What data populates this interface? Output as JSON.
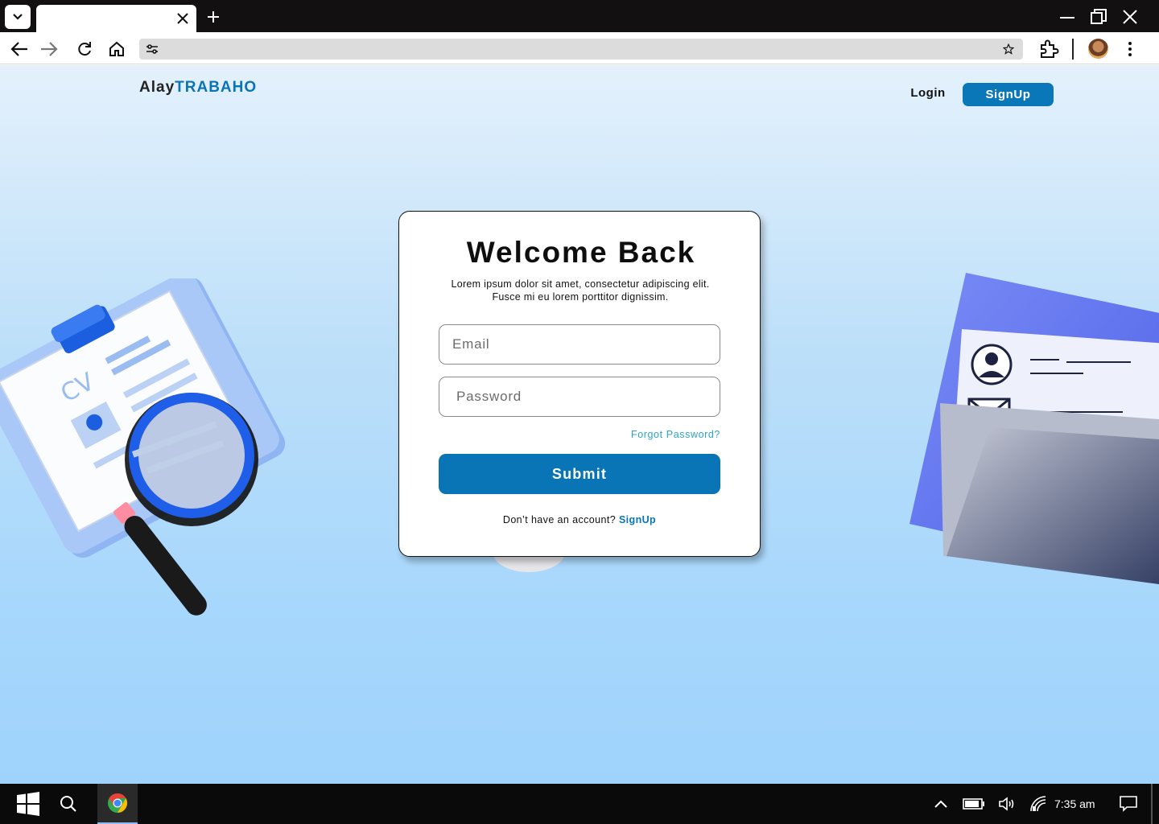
{
  "browser": {
    "tab_title": "",
    "address": "",
    "icons": [
      "tab-menu-icon",
      "close-icon",
      "plus-icon",
      "minimize-icon",
      "restore-icon",
      "close-window-icon",
      "back-icon",
      "forward-icon",
      "reload-icon",
      "home-icon",
      "tune-icon",
      "star-icon",
      "extensions-icon",
      "more-icon"
    ]
  },
  "page": {
    "brand": {
      "prefix": "Alay",
      "accent": "TRABAHO"
    },
    "nav": {
      "login": "Login",
      "signup": "SignUp"
    },
    "card": {
      "title": "Welcome Back",
      "subtitle_line1": "Lorem ipsum dolor sit amet, consectetur adipiscing elit.",
      "subtitle_line2": "Fusce mi eu lorem porttitor dignissim.",
      "email_placeholder": "Email",
      "password_placeholder": "Password",
      "forgot": "Forgot Password?",
      "submit": "Submit",
      "footer_text": "Don’t have an account?",
      "footer_link": "SignUp"
    },
    "illustration_left_label": "CV",
    "colors": {
      "accent": "#0a75b6",
      "link": "#2aa5c8"
    }
  },
  "taskbar": {
    "clock": "7:35 am",
    "icons": [
      "windows-start-icon",
      "search-icon",
      "chrome-icon",
      "chevron-up-icon",
      "battery-icon",
      "volume-icon",
      "network-icon",
      "notification-icon"
    ]
  }
}
